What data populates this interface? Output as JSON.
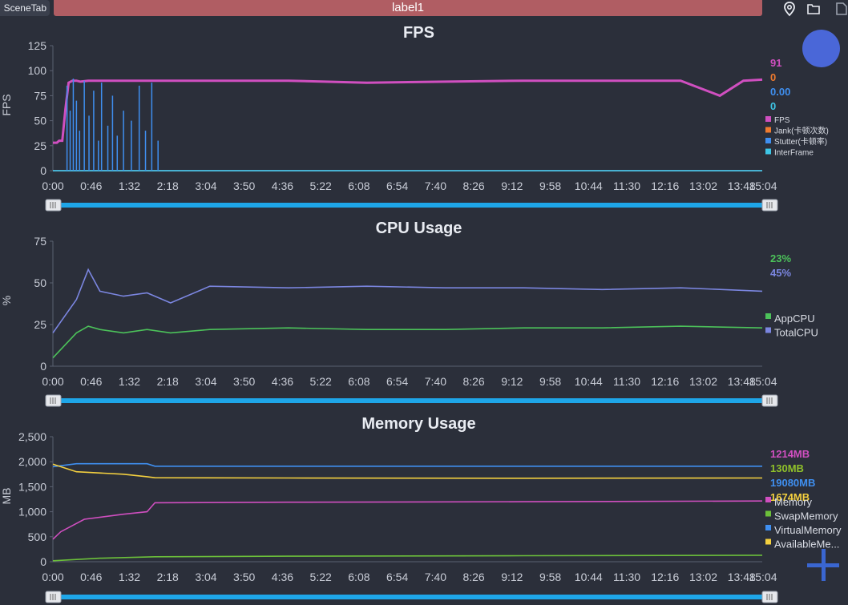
{
  "topbar": {
    "scene_tab": "SceneTab",
    "label_tab": "label1"
  },
  "time_axis": [
    "0:00",
    "0:46",
    "1:32",
    "2:18",
    "3:04",
    "3:50",
    "4:36",
    "5:22",
    "6:08",
    "6:54",
    "7:40",
    "8:26",
    "9:12",
    "9:58",
    "10:44",
    "11:30",
    "12:16",
    "13:02",
    "13:48",
    "15:04"
  ],
  "fps_panel": {
    "title": "FPS",
    "ylabel": "FPS",
    "yticks": [
      "0",
      "25",
      "50",
      "75",
      "100",
      "125"
    ],
    "current": [
      {
        "text": "91",
        "color": "#d04fc0"
      },
      {
        "text": "0",
        "color": "#ee7a2e"
      },
      {
        "text": "0.00",
        "color": "#3f8ff0"
      },
      {
        "text": "0",
        "color": "#3ec6e6"
      }
    ],
    "legend": [
      {
        "label": "FPS",
        "color": "#d04fc0"
      },
      {
        "label": "Jank(卡顿次数)",
        "color": "#ee7a2e"
      },
      {
        "label": "Stutter(卡顿率)",
        "color": "#3f8ff0"
      },
      {
        "label": "InterFrame",
        "color": "#3ec6e6"
      }
    ]
  },
  "cpu_panel": {
    "title": "CPU Usage",
    "ylabel": "%",
    "yticks": [
      "0",
      "25",
      "50",
      "75"
    ],
    "current": [
      {
        "text": "23%",
        "color": "#4cc25a"
      },
      {
        "text": "45%",
        "color": "#7b86e0"
      }
    ],
    "legend": [
      {
        "label": "AppCPU",
        "color": "#4cc25a"
      },
      {
        "label": "TotalCPU",
        "color": "#7b86e0"
      }
    ]
  },
  "memory_panel": {
    "title": "Memory Usage",
    "ylabel": "MB",
    "yticks": [
      "0",
      "500",
      "1,000",
      "1,500",
      "2,000",
      "2,500"
    ],
    "current": [
      {
        "text": "1214MB",
        "color": "#d04fc0"
      },
      {
        "text": "130MB",
        "color": "#8fc02a"
      },
      {
        "text": "19080MB",
        "color": "#3f8ff0"
      },
      {
        "text": "1674MB",
        "color": "#f4d03f"
      }
    ],
    "legend": [
      {
        "label": "Memory",
        "color": "#d04fc0"
      },
      {
        "label": "SwapMemory",
        "color": "#6cc03a"
      },
      {
        "label": "VirtualMemory",
        "color": "#3f8ff0"
      },
      {
        "label": "AvailableMe...",
        "color": "#f4d03f"
      }
    ]
  },
  "chart_data": [
    {
      "type": "line",
      "title": "FPS",
      "ylabel": "FPS",
      "ylim": [
        0,
        125
      ],
      "x_range": [
        "0:00",
        "15:04"
      ],
      "series": [
        {
          "name": "FPS",
          "x_min": [
            0,
            5,
            8,
            12,
            16,
            20,
            25,
            30,
            35,
            45,
            60,
            90,
            120,
            300,
            400,
            600,
            800,
            850,
            880,
            904
          ],
          "values": [
            28,
            28,
            30,
            30,
            62,
            88,
            90,
            90,
            89,
            90,
            90,
            90,
            90,
            90,
            88,
            90,
            90,
            75,
            90,
            91
          ]
        },
        {
          "name": "Jank(卡顿次数)",
          "x_min": [
            0,
            904
          ],
          "values": [
            0,
            0
          ]
        },
        {
          "name": "Stutter(卡顿率)",
          "x_min": [
            0,
            904
          ],
          "values": [
            0,
            0
          ]
        },
        {
          "name": "InterFrame",
          "x_min": [
            0,
            904
          ],
          "values": [
            0,
            0
          ]
        }
      ]
    },
    {
      "type": "line",
      "title": "CPU Usage",
      "ylabel": "%",
      "ylim": [
        0,
        75
      ],
      "x_range": [
        "0:00",
        "15:04"
      ],
      "series": [
        {
          "name": "AppCPU",
          "x_min": [
            0,
            30,
            45,
            60,
            90,
            120,
            150,
            200,
            300,
            400,
            500,
            600,
            700,
            800,
            904
          ],
          "values": [
            5,
            20,
            24,
            22,
            20,
            22,
            20,
            22,
            23,
            22,
            22,
            23,
            23,
            24,
            23
          ]
        },
        {
          "name": "TotalCPU",
          "x_min": [
            0,
            30,
            45,
            60,
            90,
            120,
            150,
            200,
            300,
            400,
            500,
            600,
            700,
            800,
            904
          ],
          "values": [
            20,
            40,
            58,
            45,
            42,
            44,
            38,
            48,
            47,
            48,
            47,
            47,
            46,
            47,
            45
          ]
        }
      ]
    },
    {
      "type": "line",
      "title": "Memory Usage",
      "ylabel": "MB",
      "ylim": [
        0,
        2500
      ],
      "x_range": [
        "0:00",
        "15:04"
      ],
      "series": [
        {
          "name": "Memory",
          "x_min": [
            0,
            10,
            40,
            90,
            120,
            130,
            300,
            600,
            904
          ],
          "values": [
            450,
            600,
            850,
            950,
            1000,
            1180,
            1190,
            1200,
            1214
          ]
        },
        {
          "name": "SwapMemory",
          "x_min": [
            0,
            60,
            130,
            300,
            600,
            904
          ],
          "values": [
            20,
            70,
            100,
            110,
            120,
            130
          ]
        },
        {
          "name": "VirtualMemory",
          "x_min": [
            0,
            30,
            120,
            130,
            904
          ],
          "values": [
            1900,
            1960,
            1960,
            1910,
            1910
          ]
        },
        {
          "name": "AvailableMe...",
          "x_min": [
            0,
            30,
            90,
            120,
            130,
            300,
            600,
            904
          ],
          "values": [
            1950,
            1800,
            1750,
            1700,
            1680,
            1675,
            1670,
            1674
          ]
        }
      ]
    }
  ]
}
